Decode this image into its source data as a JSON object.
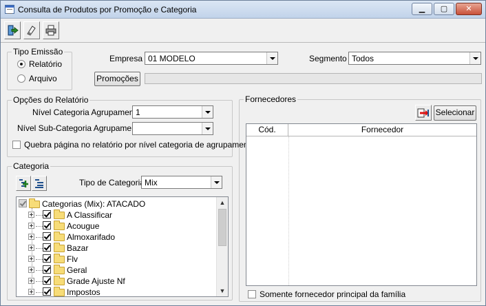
{
  "window": {
    "title": "Consulta de Produtos por Promoção e Categoria",
    "controls": {
      "minimize": "▁",
      "maximize": "▢",
      "close": "✕"
    }
  },
  "toolbar": {
    "buttons": [
      {
        "name": "exit-icon"
      },
      {
        "name": "eraser-icon"
      },
      {
        "name": "printer-icon"
      }
    ]
  },
  "tipo_emissao": {
    "title": "Tipo Emissão",
    "options": [
      "Relatório",
      "Arquivo"
    ],
    "selected": "Relatório"
  },
  "empresa": {
    "label": "Empresa",
    "value": "01 MODELO"
  },
  "segmento": {
    "label": "Segmento",
    "value": "Todos"
  },
  "promocoes": {
    "button_label": "Promoções",
    "value": ""
  },
  "opcoes_relatorio": {
    "title": "Opções do Relatório",
    "nivel_categoria_label": "Nível Categoria Agrupamento",
    "nivel_categoria_value": "1",
    "nivel_subcategoria_label": "Nível Sub-Categoria Agrupamento",
    "nivel_subcategoria_value": "",
    "quebra_pagina_label": "Quebra página no relatório por nível categoria de agrupamento",
    "quebra_pagina_checked": false
  },
  "categoria": {
    "title": "Categoria",
    "tipo_label": "Tipo de Categoria",
    "tipo_value": "Mix",
    "tree": {
      "root": "Categorias (Mix): ATACADO",
      "items": [
        {
          "label": " A Classificar",
          "checked": true
        },
        {
          "label": "Acougue",
          "checked": true
        },
        {
          "label": "Almoxarifado",
          "checked": true
        },
        {
          "label": "Bazar",
          "checked": true
        },
        {
          "label": "Flv",
          "checked": true
        },
        {
          "label": "Geral",
          "checked": true
        },
        {
          "label": "Grade Ajuste Nf",
          "checked": true
        },
        {
          "label": "Impostos",
          "checked": true
        }
      ]
    },
    "scrollbar": {
      "position": 0
    }
  },
  "fornecedores": {
    "title": "Fornecedores",
    "selecionar_label": "Selecionar",
    "columns": [
      "Cód.",
      "Fornecedor"
    ],
    "rows": [],
    "somente_principal_label": "Somente fornecedor principal da família",
    "somente_principal_checked": false
  },
  "colors": {
    "title_bar": "#c1d3ea",
    "folder": "#f7dc78",
    "close_button": "#c8513a"
  }
}
